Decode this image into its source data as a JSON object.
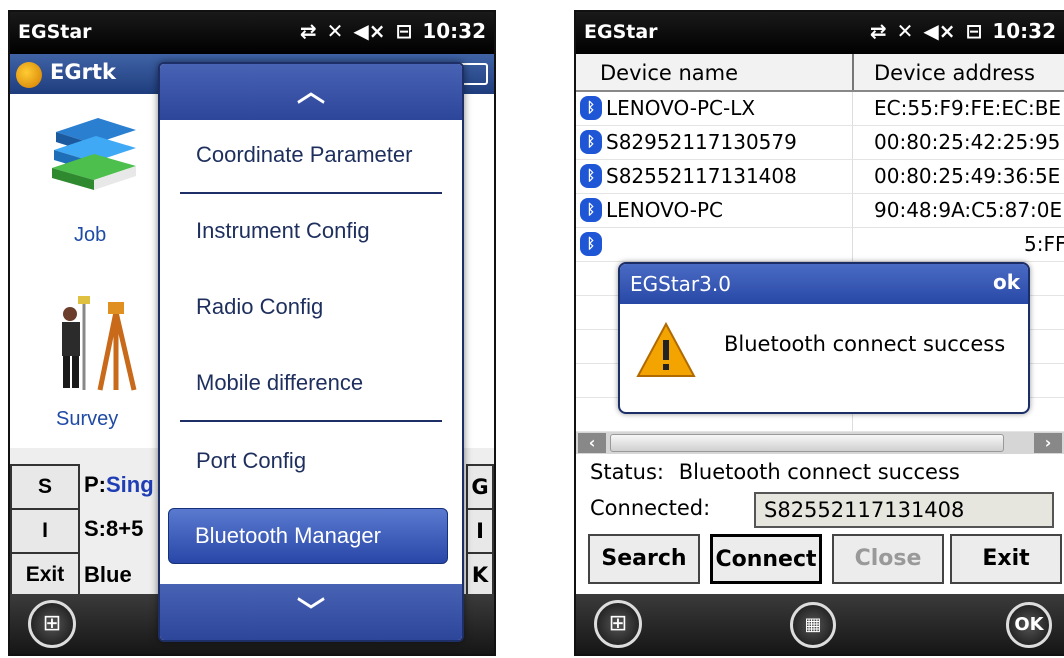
{
  "left": {
    "statusbar": {
      "title": "EGStar",
      "clock": "10:32"
    },
    "app_title": "EGrtk",
    "tiles": [
      {
        "label": "Job"
      },
      {
        "label": "Survey"
      }
    ],
    "side_buttons": [
      "S",
      "I",
      "Exit"
    ],
    "info": {
      "p_label": "P:",
      "p_value": "Sing",
      "s_label": "S:",
      "s_value": "8+5",
      "blue": "Blue"
    },
    "right_stubs": [
      "G",
      "I",
      "K"
    ],
    "menu": {
      "items": [
        "Coordinate Parameter",
        "Instrument Config",
        "Radio Config",
        "Mobile difference",
        "Port Config",
        "Bluetooth Manager"
      ],
      "selected": "Bluetooth Manager"
    }
  },
  "right": {
    "statusbar": {
      "title": "EGStar",
      "clock": "10:32"
    },
    "table": {
      "headers": [
        "Device name",
        "Device address"
      ],
      "rows": [
        {
          "name": "LENOVO-PC-LX",
          "address": "EC:55:F9:FE:EC:BE"
        },
        {
          "name": "S82952117130579",
          "address": "00:80:25:42:25:95"
        },
        {
          "name": "S82552117131408",
          "address": "00:80:25:49:36:5E"
        },
        {
          "name": "LENOVO-PC",
          "address": "90:48:9A:C5:87:0E"
        },
        {
          "name": "",
          "address": "5:FF"
        }
      ]
    },
    "dialog": {
      "title": "EGStar3.0",
      "ok": "ok",
      "message": "Bluetooth connect success"
    },
    "status_label": "Status:",
    "status_value": "Bluetooth connect success",
    "connected_label": "Connected:",
    "connected_value": "S82552117131408",
    "buttons": [
      "Search",
      "Connect",
      "Close",
      "Exit"
    ],
    "taskbar_ok": "OK"
  },
  "colors": {
    "accent": "#2d469a",
    "bluetooth": "#1e56d6",
    "link": "#1f4aa6"
  }
}
